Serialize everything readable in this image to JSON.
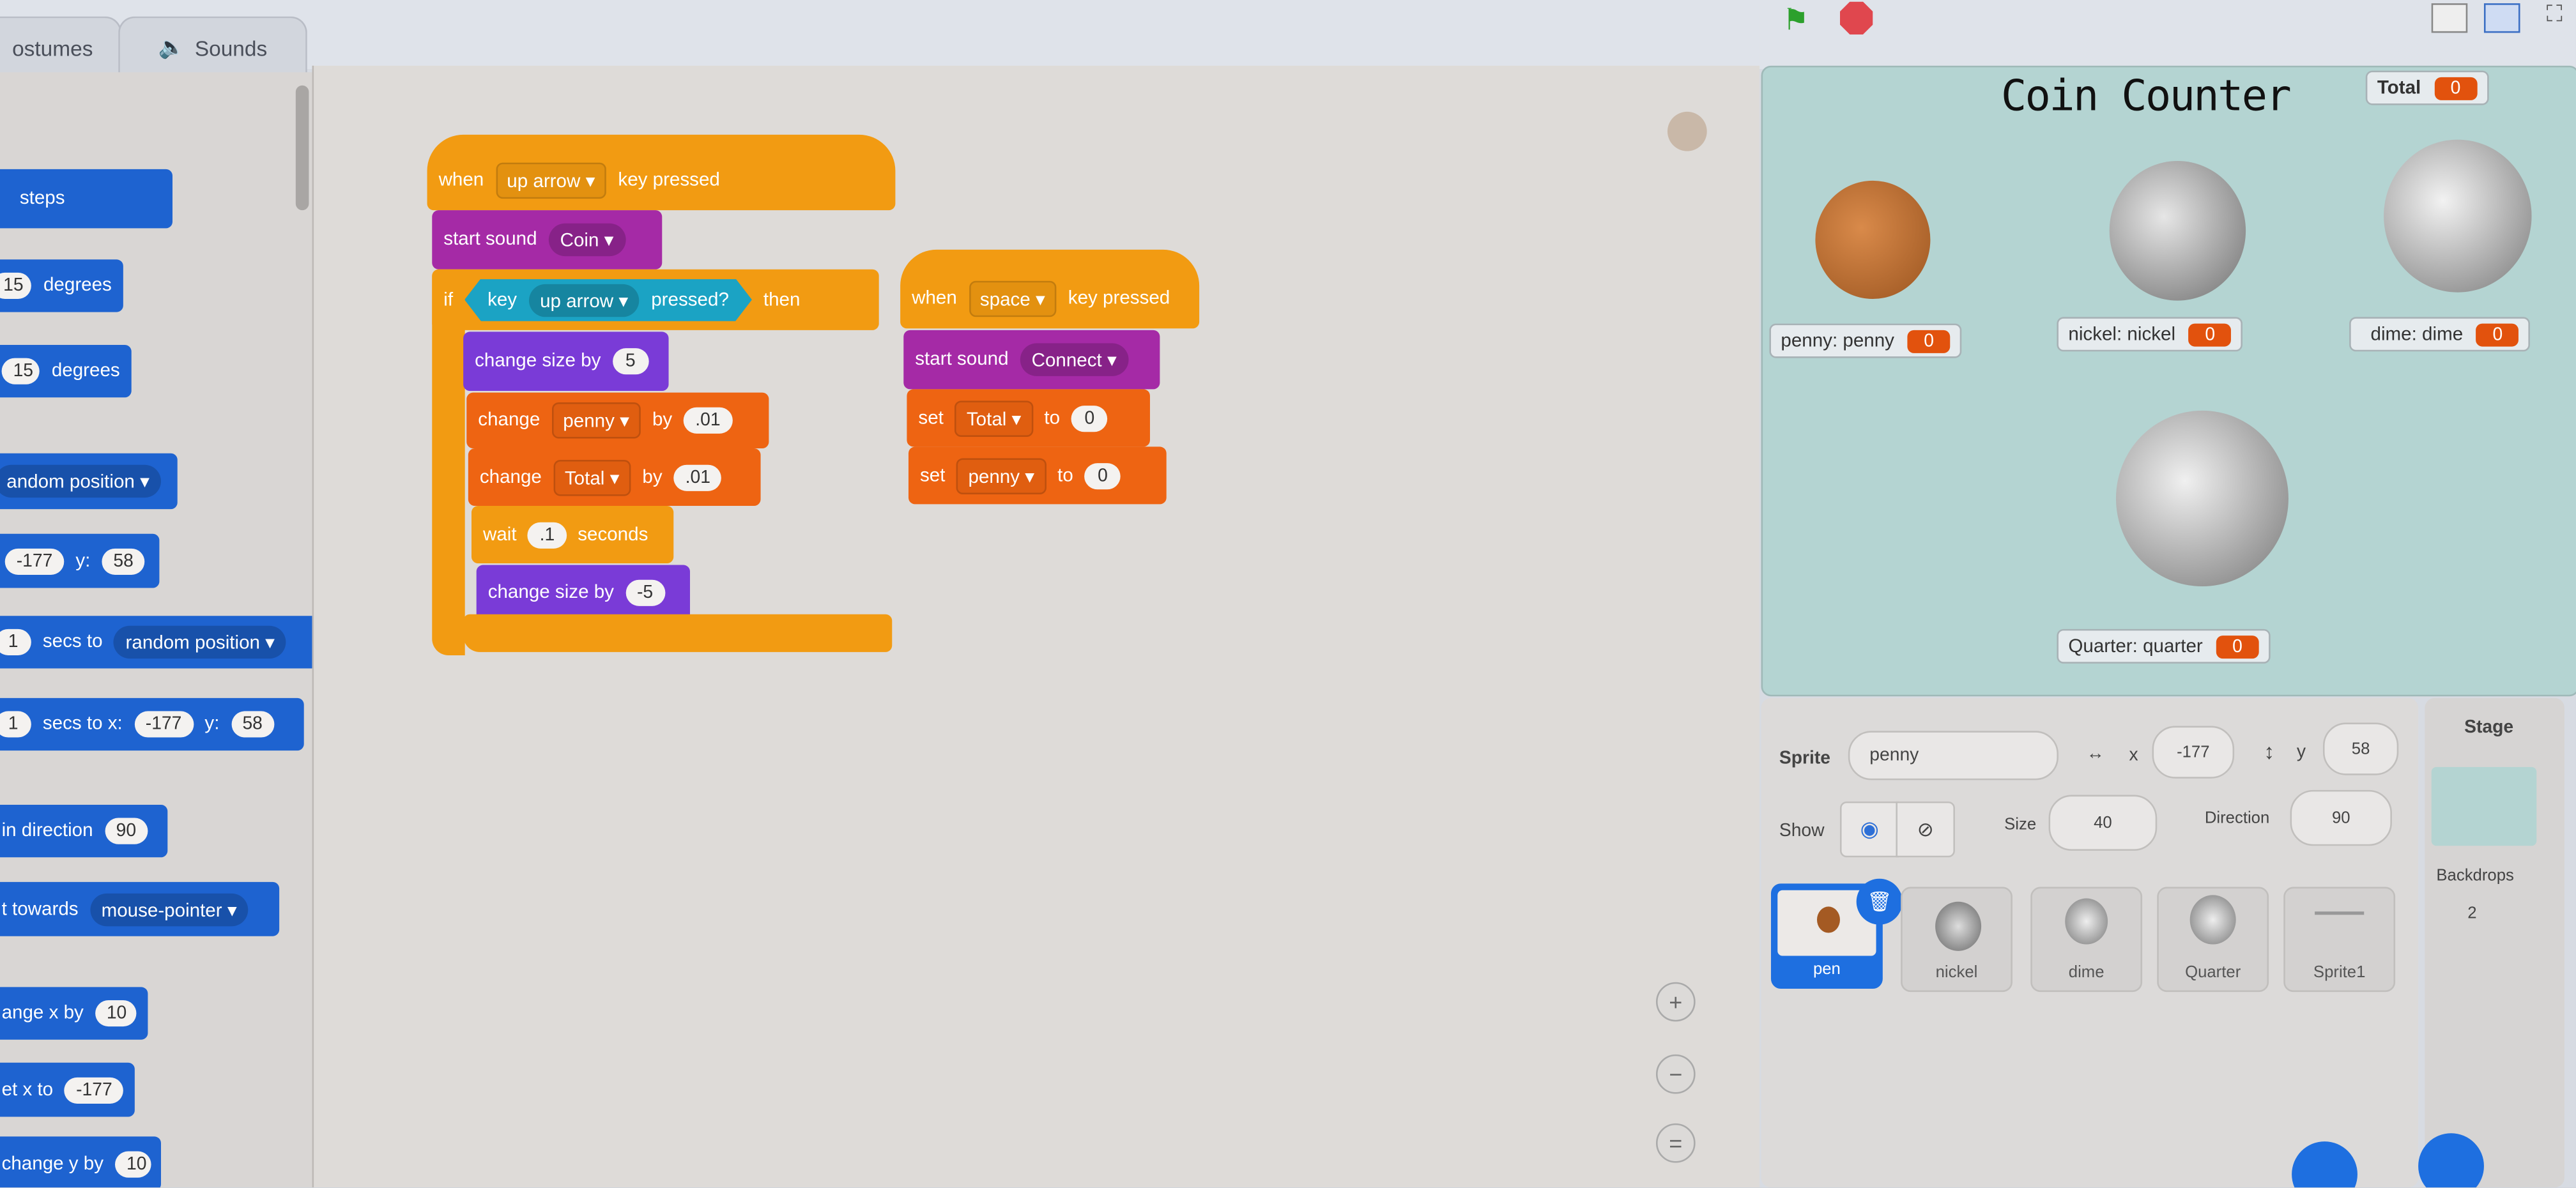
{
  "tabs": {
    "costumes": "ostumes",
    "sounds": "Sounds"
  },
  "icons": {
    "sounds": "speaker-icon",
    "flag": "green-flag-icon",
    "stop": "stop-icon",
    "zoom_in": "zoom-in-icon",
    "zoom_out": "zoom-out-icon",
    "reset": "zoom-reset-icon",
    "delete": "trash-icon",
    "show": "eye-icon",
    "hide": "eye-slash-icon"
  },
  "colors": {
    "motion": "#1e63d0",
    "events": "#f29b12",
    "sound": "#a52aa6",
    "looks": "#7a3bd7",
    "variables": "#ee6412",
    "sensing": "#1ba3c4",
    "stage_bg": "#b4d4d2",
    "monitor_value": "#e2520d",
    "selected": "#1e6fe0"
  },
  "palette": {
    "b1": {
      "t1": "steps"
    },
    "b2": {
      "n1": "15",
      "t1": "degrees"
    },
    "b3": {
      "n1": "15",
      "t1": "degrees"
    },
    "b4": {
      "d1": "andom position"
    },
    "b5": {
      "n1": "-177",
      "t1": "y:",
      "n2": "58"
    },
    "b6": {
      "n1": "1",
      "t1": "secs to",
      "d1": "random position"
    },
    "b7": {
      "n1": "1",
      "t1": "secs to x:",
      "n2": "-177",
      "t2": "y:",
      "n3": "58"
    },
    "b8": {
      "t1": "in direction",
      "n1": "90"
    },
    "b9": {
      "t1": "t towards",
      "d1": "mouse-pointer"
    },
    "b10": {
      "t1": "ange x by",
      "n1": "10"
    },
    "b11": {
      "t1": "et x to",
      "n1": "-177"
    },
    "b12": {
      "t1": "change y by",
      "n1": "10"
    }
  },
  "script1": {
    "hat": {
      "t1": "when",
      "d1": "up arrow",
      "t2": "key pressed"
    },
    "sound": {
      "t1": "start sound",
      "d1": "Coin"
    },
    "if": {
      "t1": "if",
      "t2": "key",
      "d1": "up arrow",
      "t3": "pressed?",
      "t4": "then"
    },
    "size1": {
      "t1": "change size by",
      "n1": "5"
    },
    "chg1": {
      "t1": "change",
      "d1": "penny",
      "t2": "by",
      "n1": ".01"
    },
    "chg2": {
      "t1": "change",
      "d1": "Total",
      "t2": "by",
      "n1": ".01"
    },
    "wait": {
      "t1": "wait",
      "n1": ".1",
      "t2": "seconds"
    },
    "size2": {
      "t1": "change size by",
      "n1": "-5"
    }
  },
  "script2": {
    "hat": {
      "t1": "when",
      "d1": "space",
      "t2": "key pressed"
    },
    "sound": {
      "t1": "start sound",
      "d1": "Connect"
    },
    "set1": {
      "t1": "set",
      "d1": "Total",
      "t2": "to",
      "n1": "0"
    },
    "set2": {
      "t1": "set",
      "d1": "penny",
      "t2": "to",
      "n1": "0"
    }
  },
  "stage": {
    "title": "Coin Counter",
    "monitors": {
      "total": {
        "label": "Total",
        "value": "0"
      },
      "penny": {
        "label": "penny: penny",
        "value": "0"
      },
      "nickel": {
        "label": "nickel: nickel",
        "value": "0"
      },
      "dime": {
        "label": "dime: dime",
        "value": "0"
      },
      "quarter": {
        "label": "Quarter: quarter",
        "value": "0"
      }
    }
  },
  "sprite_info": {
    "sprite_label": "Sprite",
    "name": "penny",
    "x_label": "x",
    "x": "-177",
    "y_label": "y",
    "y": "58",
    "show_label": "Show",
    "size_label": "Size",
    "size": "40",
    "direction_label": "Direction",
    "direction": "90"
  },
  "sprites": [
    {
      "name": "pen"
    },
    {
      "name": "nickel"
    },
    {
      "name": "dime"
    },
    {
      "name": "Quarter"
    },
    {
      "name": "Sprite1"
    }
  ],
  "stage_pane": {
    "title": "Stage",
    "backdrops_label": "Backdrops",
    "backdrops_count": "2"
  }
}
